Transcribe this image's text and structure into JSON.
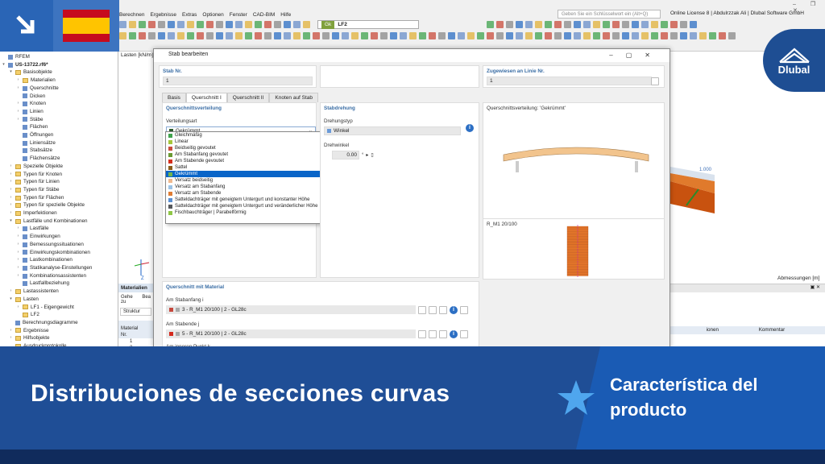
{
  "app": {
    "menu": [
      "Berechnen",
      "Ergebnisse",
      "Extras",
      "Optionen",
      "Fenster",
      "CAD-BIM",
      "Hilfe"
    ],
    "search_placeholder": "Geben Sie ein Schlüsselwort ein (Alt+Q)",
    "license": "Online License 8 | Abdulrzzak Ali | Dlubal Software GmbH",
    "load_case_badge": "Gk",
    "load_case": "LF2",
    "window_controls": "– ❐ ✕"
  },
  "nav": {
    "items": [
      {
        "label": "RFEM",
        "lvl": 0,
        "t": "",
        "i": "ico"
      },
      {
        "label": "US-13722.rf6*",
        "lvl": 0,
        "t": "▾",
        "i": "ico",
        "b": true
      },
      {
        "label": "Basisobjekte",
        "lvl": 1,
        "t": "▾",
        "i": "fold"
      },
      {
        "label": "Materialien",
        "lvl": 2,
        "t": "›",
        "i": "fold"
      },
      {
        "label": "Querschnitte",
        "lvl": 2,
        "t": "›",
        "i": "ico"
      },
      {
        "label": "Dicken",
        "lvl": 2,
        "t": "",
        "i": "ico"
      },
      {
        "label": "Knoten",
        "lvl": 2,
        "t": "›",
        "i": "ico"
      },
      {
        "label": "Linien",
        "lvl": 2,
        "t": "›",
        "i": "ico"
      },
      {
        "label": "Stäbe",
        "lvl": 2,
        "t": "›",
        "i": "ico"
      },
      {
        "label": "Flächen",
        "lvl": 2,
        "t": "",
        "i": "ico"
      },
      {
        "label": "Öffnungen",
        "lvl": 2,
        "t": "",
        "i": "ico"
      },
      {
        "label": "Liniensätze",
        "lvl": 2,
        "t": "",
        "i": "ico"
      },
      {
        "label": "Stabsätze",
        "lvl": 2,
        "t": "",
        "i": "ico"
      },
      {
        "label": "Flächensätze",
        "lvl": 2,
        "t": "",
        "i": "ico"
      },
      {
        "label": "Spezielle Objekte",
        "lvl": 1,
        "t": "›",
        "i": "fold"
      },
      {
        "label": "Typen für Knoten",
        "lvl": 1,
        "t": "›",
        "i": "fold"
      },
      {
        "label": "Typen für Linien",
        "lvl": 1,
        "t": "›",
        "i": "fold"
      },
      {
        "label": "Typen für Stäbe",
        "lvl": 1,
        "t": "›",
        "i": "fold"
      },
      {
        "label": "Typen für Flächen",
        "lvl": 1,
        "t": "›",
        "i": "fold"
      },
      {
        "label": "Typen für spezielle Objekte",
        "lvl": 1,
        "t": "›",
        "i": "fold"
      },
      {
        "label": "Imperfektionen",
        "lvl": 1,
        "t": "›",
        "i": "fold"
      },
      {
        "label": "Lastfälle und Kombinationen",
        "lvl": 1,
        "t": "▾",
        "i": "fold"
      },
      {
        "label": "Lastfälle",
        "lvl": 2,
        "t": "›",
        "i": "ico"
      },
      {
        "label": "Einwirkungen",
        "lvl": 2,
        "t": "›",
        "i": "ico"
      },
      {
        "label": "Bemessungssituationen",
        "lvl": 2,
        "t": "›",
        "i": "ico"
      },
      {
        "label": "Einwirkungskombinationen",
        "lvl": 2,
        "t": "›",
        "i": "ico"
      },
      {
        "label": "Lastkombinationen",
        "lvl": 2,
        "t": "›",
        "i": "ico"
      },
      {
        "label": "Statikanalyse-Einstellungen",
        "lvl": 2,
        "t": "›",
        "i": "ico"
      },
      {
        "label": "Kombinationsassistenten",
        "lvl": 2,
        "t": "›",
        "i": "ico"
      },
      {
        "label": "Lastfallbeziehung",
        "lvl": 2,
        "t": "",
        "i": "ico"
      },
      {
        "label": "Lastassistenten",
        "lvl": 1,
        "t": "›",
        "i": "fold"
      },
      {
        "label": "Lasten",
        "lvl": 1,
        "t": "▾",
        "i": "fold"
      },
      {
        "label": "LF1 - Eigengewicht",
        "lvl": 2,
        "t": "›",
        "i": "fold"
      },
      {
        "label": "LF2",
        "lvl": 2,
        "t": "",
        "i": "fold"
      },
      {
        "label": "Berechnungsdiagramme",
        "lvl": 1,
        "t": "",
        "i": "ico"
      },
      {
        "label": "Ergebnisse",
        "lvl": 1,
        "t": "›",
        "i": "fold"
      },
      {
        "label": "Hilfsobjekte",
        "lvl": 1,
        "t": "›",
        "i": "fold"
      },
      {
        "label": "Ausdruckprotokolle",
        "lvl": 1,
        "t": "",
        "i": "fold"
      }
    ]
  },
  "bg": {
    "title": "Lasten [kN/m]",
    "dim": "Abmessungen [m]",
    "value": "1.000",
    "materials_tab": "Materialien",
    "goto": "Gehe zu",
    "bea": "Bea",
    "struktur": "Struktur",
    "material_col": "Material",
    "nr_col": "Nr.",
    "row1": "1",
    "row2": "2",
    "col_ionen": "ionen",
    "col_comment": "Kommentar",
    "axis_z": "Z"
  },
  "dialog": {
    "title": "Stab bearbeiten",
    "stab_nr_label": "Stab Nr.",
    "stab_nr": "1",
    "assigned_label": "Zugewiesen an Linie Nr.",
    "assigned": "1",
    "tabs": [
      "Basis",
      "Querschnitt I",
      "Querschnitt II",
      "Knoten auf Stab"
    ],
    "dist_header": "Querschnittsverteilung",
    "dist_type_label": "Verteilungsart",
    "dist_selected": "Gekrümmt",
    "options": [
      {
        "label": "Gleichmäßig",
        "color": "#3fa34d"
      },
      {
        "label": "Linear",
        "color": "#a5c63b"
      },
      {
        "label": "Beidseitig gevoutet",
        "color": "#c94c3c"
      },
      {
        "label": "Am Stabanfang gevoutet",
        "color": "#6a9a32"
      },
      {
        "label": "Am Stabende gevoutet",
        "color": "#d4301e"
      },
      {
        "label": "Sattel",
        "color": "#8a5d1a"
      },
      {
        "label": "Gekrümmt",
        "color": "#0a65c8",
        "sel": true
      },
      {
        "label": "Versatz beidseitig",
        "color": "#efb98f"
      },
      {
        "label": "Versatz am Stabanfang",
        "color": "#9cc3e6"
      },
      {
        "label": "Versatz am Stabende",
        "color": "#e07d34"
      },
      {
        "label": "Satteldachträger mit geneigtem Untergurt und konstanter Höhe",
        "color": "#5b8fd1"
      },
      {
        "label": "Satteldachträger mit geneigtem Untergurt und veränderlicher Höhe",
        "color": "#55585c"
      },
      {
        "label": "Fischbauchträger | Parabelförmig",
        "color": "#8fc646"
      }
    ],
    "rot_header": "Stabdrehung",
    "rot_type_label": "Drehungstyp",
    "rot_type": "Winkel",
    "rot_angle_label": "Drehwinkel",
    "rot_angle": "0.00",
    "rot_unit": "°",
    "preview_title": "Querschnittsverteilung: 'Gekrümmt'",
    "section_name": "R_M1 20/100",
    "mat_header": "Querschnitt mit Material",
    "start_label": "Am Stabanfang i",
    "start_value": "3 - R_M1 20/100 | 2 - GL28c",
    "end_label": "Am Stabende j",
    "end_value": "5 - R_M1 20/100 | 2 - GL28c",
    "inner_label": "Am inneren Punkt k"
  },
  "banner": {
    "title": "Distribuciones de secciones curvas",
    "feature_line1": "Característica del",
    "feature_line2": "producto",
    "brand": "Dlubal"
  }
}
